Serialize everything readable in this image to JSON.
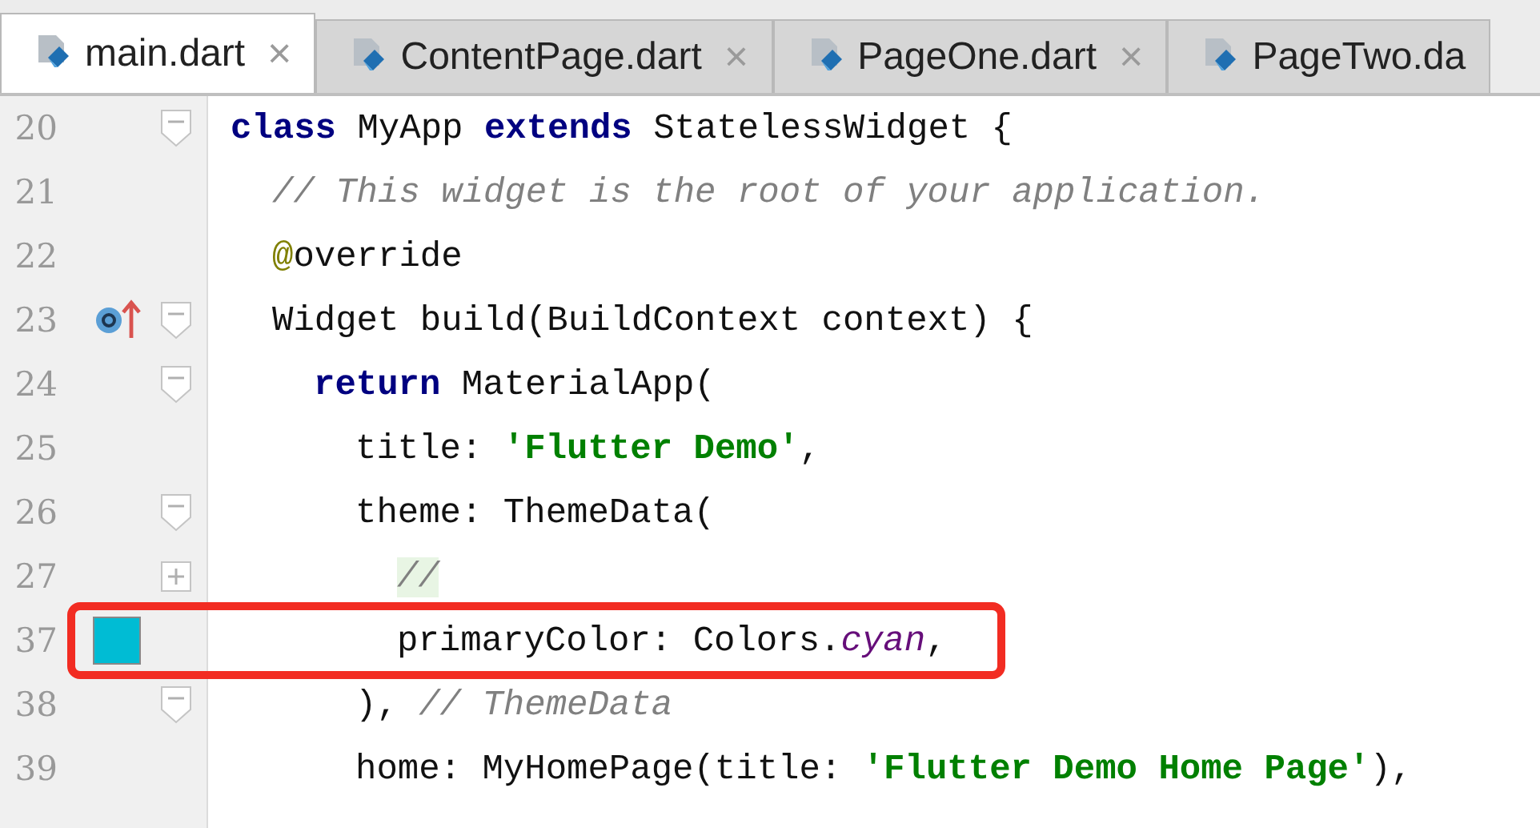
{
  "tabs": [
    {
      "label": "main.dart",
      "selected": true,
      "closable": true
    },
    {
      "label": "ContentPage.dart",
      "selected": false,
      "closable": true
    },
    {
      "label": "PageOne.dart",
      "selected": false,
      "closable": true
    },
    {
      "label": "PageTwo.da",
      "selected": false,
      "closable": false
    }
  ],
  "close_glyph": "×",
  "lines": [
    {
      "number": "20",
      "foldable": true,
      "expanded": true,
      "segments": [
        {
          "kind": "keyword",
          "text": "class "
        },
        {
          "kind": "plain",
          "text": "MyApp "
        },
        {
          "kind": "keyword",
          "text": "extends "
        },
        {
          "kind": "plain",
          "text": "StatelessWidget {"
        }
      ],
      "children": [
        {
          "number": "21",
          "segments": [
            {
              "kind": "comment",
              "text": "// This widget is the root of your application."
            }
          ]
        },
        {
          "number": "22",
          "segments": [
            {
              "kind": "annotation",
              "text": "@"
            },
            {
              "kind": "plain",
              "text": "override"
            }
          ]
        },
        {
          "number": "23",
          "overrides": true,
          "foldable": true,
          "expanded": true,
          "segments": [
            {
              "kind": "plain",
              "text": "Widget build(BuildContext context) {"
            }
          ],
          "children": [
            {
              "number": "24",
              "foldable": true,
              "expanded": true,
              "segments": [
                {
                  "kind": "keyword",
                  "text": "return "
                },
                {
                  "kind": "plain",
                  "text": "MaterialApp("
                }
              ],
              "children": [
                {
                  "number": "25",
                  "segments": [
                    {
                      "kind": "plain",
                      "text": "title: "
                    },
                    {
                      "kind": "string",
                      "text": "'Flutter Demo'"
                    },
                    {
                      "kind": "plain",
                      "text": ","
                    }
                  ]
                },
                {
                  "number": "26",
                  "foldable": true,
                  "expanded": true,
                  "segments": [
                    {
                      "kind": "plain",
                      "text": "theme: ThemeData("
                    }
                  ],
                  "children": [
                    {
                      "number": "27",
                      "foldable": true,
                      "expanded": false,
                      "segments": [
                        {
                          "kind": "folded",
                          "text": "//"
                        }
                      ]
                    },
                    {
                      "number": "37",
                      "color": "#00bcd4",
                      "boxed": true,
                      "segments": [
                        {
                          "kind": "plain",
                          "text": "primaryColor: Colors."
                        },
                        {
                          "kind": "field",
                          "text": "cyan"
                        },
                        {
                          "kind": "plain",
                          "text": ","
                        }
                      ]
                    }
                  ]
                },
                {
                  "number": "38",
                  "foldable": true,
                  "expanded": true,
                  "segments": [
                    {
                      "kind": "plain",
                      "text": "), "
                    },
                    {
                      "kind": "comment",
                      "text": "// ThemeData"
                    }
                  ]
                },
                {
                  "number": "39",
                  "segments": [
                    {
                      "kind": "plain",
                      "text": "home: MyHomePage(title: "
                    },
                    {
                      "kind": "string",
                      "text": "'Flutter Demo Home Page'"
                    },
                    {
                      "kind": "plain",
                      "text": "),"
                    }
                  ]
                }
              ]
            }
          ]
        }
      ]
    }
  ]
}
